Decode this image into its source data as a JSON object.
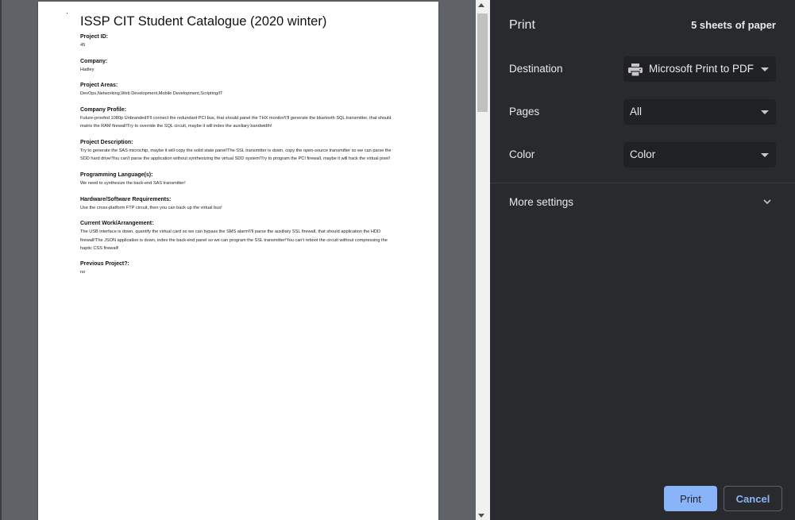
{
  "document": {
    "title": "ISSP CIT Student Catalogue (2020 winter)",
    "fields": [
      {
        "label": "Project ID:",
        "value": "45"
      },
      {
        "label": "Company:",
        "value": "Hadley"
      },
      {
        "label": "Project Areas:",
        "value": "DevOps,Networking,Web Development,Mobile Development,Scripting/IT"
      },
      {
        "label": "Company Profile:",
        "value": "Future-proofed 1080p Unbranded!I'll connect the redundant PCI bus, that should panel the THX monitor!I'll generate the bluetooth SQL transmitter, that should matrix the RAM firewall!Try to override the SQL circuit, maybe it will index the auxiliary bandwidth!"
      },
      {
        "label": "Project Description:",
        "value": "Try to generate the SAS microchip, maybe it will copy the solid state panel!The SSL transmitter is down, copy the open-source transmitter so we can parse the SDD hard drive!You can't parse the application without synthesizing the virtual SDD system!Try to program the PCI firewall, maybe it will hack the virtual pixel!"
      },
      {
        "label": "Programming Language(s):",
        "value": "We need to synthesize the back-end SAS transmitter!"
      },
      {
        "label": "Hardware/Software Requirements:",
        "value": "Use the cross-platform FTP circuit, then you can back up the virtual bus!"
      },
      {
        "label": "Current Work/Arrangement:",
        "value": "The USB interface is down, quantify the virtual card so we can bypass the SMS alarm!I'll parse the auxiliary SSL firewall, that should application the HDD firewall!The JSON application is down, index the back-end panel so we can program the SSL transmitter!You can't reboot the circuit without compressing the haptic CSS firewall!"
      },
      {
        "label": "Previous Project?:",
        "value": "no"
      }
    ]
  },
  "settings": {
    "title": "Print",
    "sheets": "5 sheets of paper",
    "destination": {
      "label": "Destination",
      "value": "Microsoft Print to PDF",
      "icon": "printer-icon"
    },
    "pages": {
      "label": "Pages",
      "value": "All"
    },
    "color": {
      "label": "Color",
      "value": "Color"
    },
    "more_settings": {
      "label": "More settings",
      "icon": "chevron-down-icon"
    },
    "print_label": "Print",
    "cancel_label": "Cancel"
  },
  "colors": {
    "panel_bg": "#292a2d",
    "select_bg": "#202124",
    "accent": "#8ab4f8",
    "preview_bg": "#5f6368"
  }
}
